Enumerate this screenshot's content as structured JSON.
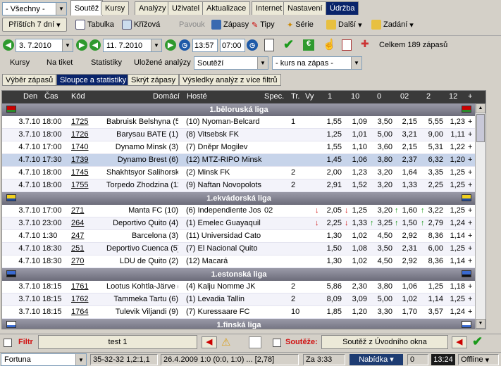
{
  "top": {
    "filter_select": "- Všechny -",
    "next_days_btn": "Příštích 7 dní",
    "tabs": [
      "Soutěž",
      "Kursy",
      "Analýzy",
      "Uživatel",
      "Aktualizace",
      "Internet",
      "Nastavení",
      "Údržba"
    ],
    "tool_tabulka": "Tabulka",
    "tool_krizova": "Křížová",
    "tool_pavouk": "Pavouk",
    "tool_zapasy": "Zápasy",
    "tool_tipy": "Tipy",
    "tool_serie": "Série",
    "tool_dalsi": "Další",
    "tool_zadani": "Zadání"
  },
  "dates": {
    "from": "3. 7.2010",
    "to": "11. 7.2010",
    "time_from": "13:57",
    "time_to": "07:00",
    "total": "Celkem 189 zápasů"
  },
  "options": {
    "kursy": "Kursy",
    "na_tiket": "Na tiket",
    "statistiky": "Statistiky",
    "ulozene": "Uložené analýzy",
    "souteze_select": "Soutěží",
    "kurs_select": "- kurs na zápas -"
  },
  "subtabs": [
    "Výběr zápasů",
    "Sloupce a statistiky",
    "Skrýt zápasy",
    "Výsledky analýz z více filtrů"
  ],
  "columns": [
    "Den",
    "Čas",
    "Kód",
    "Domácí",
    "Hosté",
    "Spec.",
    "Tr.",
    "Vy",
    "1",
    "10",
    "0",
    "02",
    "2",
    "12",
    "+"
  ],
  "leagues": [
    {
      "name": "1.běloruská liga",
      "rows": [
        {
          "den": "3.7.10",
          "cas": "18:00",
          "kod": "1725",
          "dom": "Babruisk Belshyna (5)",
          "host": "(10) Nyoman-Belcard",
          "spec": "",
          "tr": "1",
          "vy": "",
          "o1": "1,55",
          "o10": "1,09",
          "o0": "3,50",
          "o02": "2,15",
          "o2": "5,55",
          "o12": "1,23"
        },
        {
          "den": "3.7.10",
          "cas": "18:00",
          "kod": "1726",
          "dom": "Barysau BATE (1)",
          "host": "(8) Vitsebsk FK",
          "spec": "",
          "tr": "",
          "vy": "",
          "o1": "1,25",
          "o10": "1,01",
          "o0": "5,00",
          "o02": "3,21",
          "o2": "9,00",
          "o12": "1,11"
        },
        {
          "den": "4.7.10",
          "cas": "17:00",
          "kod": "1740",
          "dom": "Dynamo Minsk (3)",
          "host": "(7) Dněpr Mogilev",
          "spec": "",
          "tr": "",
          "vy": "",
          "o1": "1,55",
          "o10": "1,10",
          "o0": "3,60",
          "o02": "2,15",
          "o2": "5,31",
          "o12": "1,22"
        },
        {
          "den": "4.7.10",
          "cas": "17:30",
          "kod": "1739",
          "dom": "Dynamo Brest (6)",
          "host": "(12) MTZ-RIPO Minsk",
          "spec": "",
          "tr": "",
          "vy": "",
          "o1": "1,45",
          "o10": "1,06",
          "o0": "3,80",
          "o02": "2,37",
          "o2": "6,32",
          "o12": "1,20",
          "sel": true
        },
        {
          "den": "4.7.10",
          "cas": "18:00",
          "kod": "1745",
          "dom": "Shakhtsyor Salihorsk (4)",
          "host": "(2) Minsk FK",
          "spec": "",
          "tr": "2",
          "vy": "",
          "o1": "2,00",
          "o10": "1,23",
          "o0": "3,20",
          "o02": "1,64",
          "o2": "3,35",
          "o12": "1,25"
        },
        {
          "den": "4.7.10",
          "cas": "18:00",
          "kod": "1755",
          "dom": "Torpedo Zhodzina (11)",
          "host": "(9) Naftan Novopolots",
          "spec": "",
          "tr": "2",
          "vy": "",
          "o1": "2,91",
          "o10": "1,52",
          "o0": "3,20",
          "o02": "1,33",
          "o2": "2,25",
          "o12": "1,25"
        }
      ]
    },
    {
      "name": "1.ekvádorská liga",
      "rows": [
        {
          "den": "3.7.10",
          "cas": "17:00",
          "kod": "271",
          "dom": "Manta FC (10)",
          "host": "(6) Independiente Jos",
          "spec": "02",
          "tr": "",
          "vy": "",
          "o1": "2,05",
          "o10": "1,25",
          "o0": "3,20",
          "o02": "1,60",
          "o2": "3,22",
          "o12": "1,25",
          "a1": "dn",
          "a10": "dn",
          "a0": "",
          "a02": "up",
          "a2": "up"
        },
        {
          "den": "3.7.10",
          "cas": "23:00",
          "kod": "264",
          "dom": "Deportivo Quito (4)",
          "host": "(1) Emelec Guayaquil",
          "spec": "",
          "tr": "",
          "vy": "",
          "o1": "2,25",
          "o10": "1,33",
          "o0": "3,25",
          "o02": "1,50",
          "o2": "2,79",
          "o12": "1,24",
          "a1": "dn",
          "a10": "dn",
          "a0": "up",
          "a02": "up",
          "a2": "up"
        },
        {
          "den": "4.7.10",
          "cas": "1:30",
          "kod": "247",
          "dom": "Barcelona (3)",
          "host": "(11) Universidad Cato",
          "spec": "",
          "tr": "",
          "vy": "",
          "o1": "1,30",
          "o10": "1,02",
          "o0": "4,50",
          "o02": "2,92",
          "o2": "8,36",
          "o12": "1,14"
        },
        {
          "den": "4.7.10",
          "cas": "18:30",
          "kod": "251",
          "dom": "Deportivo Cuenca (5)",
          "host": "(7) El Nacional Quito",
          "spec": "",
          "tr": "",
          "vy": "",
          "o1": "1,50",
          "o10": "1,08",
          "o0": "3,50",
          "o02": "2,31",
          "o2": "6,00",
          "o12": "1,25"
        },
        {
          "den": "4.7.10",
          "cas": "18:30",
          "kod": "270",
          "dom": "LDU de Quito (2)",
          "host": "(12) Macará",
          "spec": "",
          "tr": "",
          "vy": "",
          "o1": "1,30",
          "o10": "1,02",
          "o0": "4,50",
          "o02": "2,92",
          "o2": "8,36",
          "o12": "1,14"
        }
      ]
    },
    {
      "name": "1.estonská liga",
      "rows": [
        {
          "den": "3.7.10",
          "cas": "18:15",
          "kod": "1761",
          "dom": "Lootus Kohtla-Järve (8)",
          "host": "(4) Kalju Nomme JK",
          "spec": "",
          "tr": "2",
          "vy": "",
          "o1": "5,86",
          "o10": "2,30",
          "o0": "3,80",
          "o02": "1,06",
          "o2": "1,25",
          "o12": "1,18"
        },
        {
          "den": "3.7.10",
          "cas": "18:15",
          "kod": "1762",
          "dom": "Tammeka Tartu (6)",
          "host": "(1) Levadia Tallin",
          "spec": "",
          "tr": "2",
          "vy": "",
          "o1": "8,09",
          "o10": "3,09",
          "o0": "5,00",
          "o02": "1,02",
          "o2": "1,14",
          "o12": "1,25"
        },
        {
          "den": "3.7.10",
          "cas": "18:15",
          "kod": "1764",
          "dom": "Tulevik Viljandi (9)",
          "host": "(7) Kuressaare FC",
          "spec": "",
          "tr": "10",
          "vy": "",
          "o1": "1,85",
          "o10": "1,20",
          "o0": "3,30",
          "o02": "1,70",
          "o2": "3,57",
          "o12": "1,24"
        }
      ]
    },
    {
      "name": "1.finská liga",
      "rows": []
    }
  ],
  "bottom": {
    "filtr": "Filtr",
    "filter_name": "test 1",
    "souteze": "Soutěže:",
    "souteze_value": "Soutěž z Úvodního okna"
  },
  "status": {
    "bookmaker": "Fortuna",
    "score1": "35-32-32  1,2:1,1",
    "score2": "26.4.2009 1:0 (0:0, 1:0) ... [2,78]",
    "za": "Za 3:33",
    "nabidka": "Nabídka",
    "zero": "0",
    "time": "13:24",
    "offline": "Offline"
  },
  "colors": {
    "selected": "#c7d4ea",
    "header": "#3a3a3a",
    "league": "#7a7a88"
  }
}
